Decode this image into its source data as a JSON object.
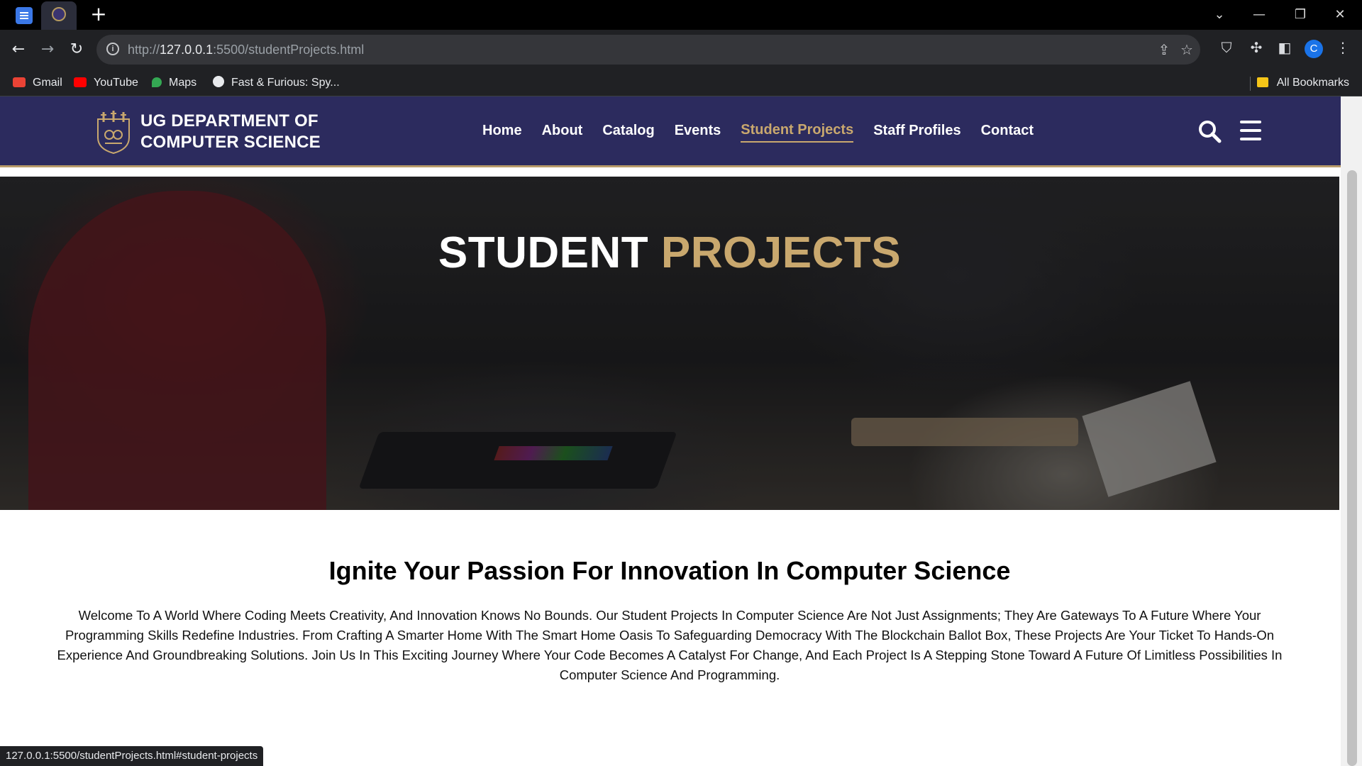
{
  "browser": {
    "new_tab_symbol": "+",
    "window_controls": {
      "dropdown": "⌄",
      "minimize": "—",
      "restore": "❐",
      "close": "✕"
    },
    "nav": {
      "back": "←",
      "forward": "→",
      "reload": "↻"
    },
    "url_prefix": "http://",
    "url_host": "127.0.0.1",
    "url_rest": ":5500/studentProjects.html",
    "profile_initial": "C",
    "bookmarks": [
      {
        "label": "Gmail",
        "icon": "gmail-icon",
        "color": "#ea4335"
      },
      {
        "label": "YouTube",
        "icon": "youtube-icon",
        "color": "#ff0000"
      },
      {
        "label": "Maps",
        "icon": "maps-icon",
        "color": "#34a853"
      },
      {
        "label": "Fast & Furious: Spy...",
        "icon": "globe-icon",
        "color": "#e8eaed"
      }
    ],
    "all_bookmarks": "All Bookmarks",
    "status_url": "127.0.0.1:5500/studentProjects.html#student-projects"
  },
  "site": {
    "brand_line1": "UG DEPARTMENT OF",
    "brand_line2": "COMPUTER SCIENCE",
    "nav": [
      {
        "label": "Home",
        "active": false
      },
      {
        "label": "About",
        "active": false
      },
      {
        "label": "Catalog",
        "active": false
      },
      {
        "label": "Events",
        "active": false
      },
      {
        "label": "Student Projects",
        "active": true
      },
      {
        "label": "Staff Profiles",
        "active": false
      },
      {
        "label": "Contact",
        "active": false
      }
    ],
    "colors": {
      "header": "#2c2b5e",
      "accent": "#c9a86e"
    }
  },
  "hero": {
    "title_white": "STUDENT",
    "title_accent": "PROJECTS"
  },
  "intro": {
    "title": "Ignite Your Passion For Innovation In Computer Science",
    "body": "Welcome To A World Where Coding Meets Creativity, And Innovation Knows No Bounds. Our Student Projects In Computer Science Are Not Just Assignments; They Are Gateways To A Future Where Your Programming Skills Redefine Industries. From Crafting A Smarter Home With The Smart Home Oasis To Safeguarding Democracy With The Blockchain Ballot Box, These Projects Are Your Ticket To Hands-On Experience And Groundbreaking Solutions. Join Us In This Exciting Journey Where Your Code Becomes A Catalyst For Change, And Each Project Is A Stepping Stone Toward A Future Of Limitless Possibilities In Computer Science And Programming."
  }
}
